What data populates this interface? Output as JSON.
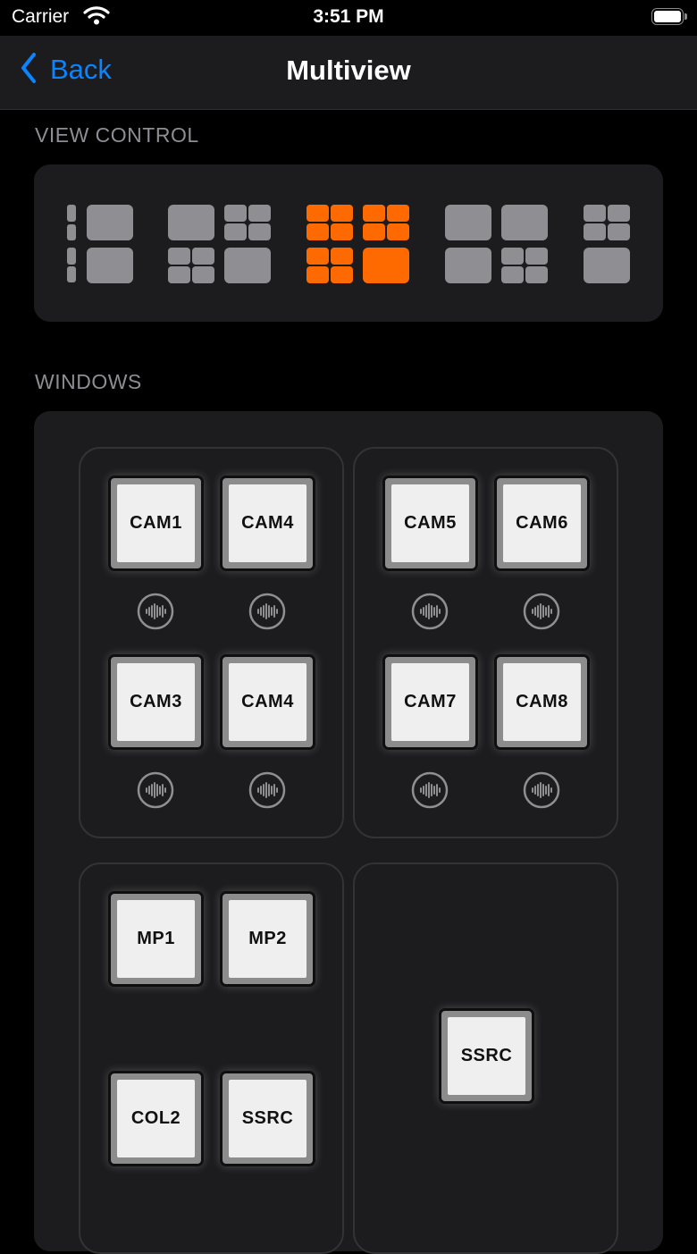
{
  "status": {
    "carrier": "Carrier",
    "time": "3:51 PM"
  },
  "nav": {
    "back_label": "Back",
    "title": "Multiview"
  },
  "sections": {
    "view_control": "VIEW CONTROL",
    "windows": "WINDOWS"
  },
  "view_control": {
    "selected_index": 2,
    "accent_color": "#ff6a00",
    "cell_color": "#8e8e93"
  },
  "windows": {
    "top_left": {
      "buttons": [
        "CAM1",
        "CAM4",
        "CAM3",
        "CAM4"
      ]
    },
    "top_right": {
      "buttons": [
        "CAM5",
        "CAM6",
        "CAM7",
        "CAM8"
      ]
    },
    "bottom_left": {
      "buttons": [
        "MP1",
        "MP2",
        "COL2",
        "SSRC"
      ]
    },
    "bottom_right": {
      "buttons": [
        "SSRC"
      ]
    }
  },
  "icons": {
    "audio": "audio-waveform-icon",
    "back": "chevron-left-icon",
    "wifi": "wifi-icon",
    "battery": "battery-icon"
  }
}
